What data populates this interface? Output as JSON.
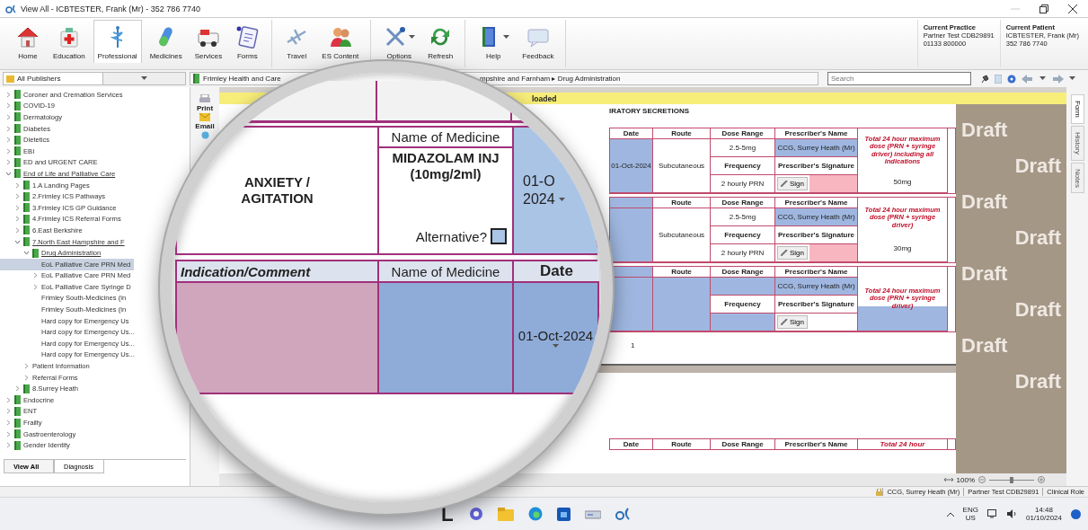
{
  "window": {
    "title": "View All  -  ICBTESTER, Frank (Mr)  -  352 786 7740"
  },
  "ribbon": {
    "groups": [
      [
        {
          "label": "Home",
          "selected": false,
          "has_menu": false
        },
        {
          "label": "Education",
          "selected": false,
          "has_menu": false
        },
        {
          "label": "Professional",
          "selected": true,
          "has_menu": false
        },
        {
          "label": "Medicines",
          "selected": false,
          "has_menu": false
        },
        {
          "label": "Services",
          "selected": false,
          "has_menu": false
        },
        {
          "label": "Forms",
          "selected": false,
          "has_menu": false
        }
      ],
      [
        {
          "label": "Travel",
          "selected": false,
          "has_menu": false
        },
        {
          "label": "ES Content",
          "selected": false,
          "has_menu": false
        }
      ],
      [
        {
          "label": "Options",
          "selected": false,
          "has_menu": true
        },
        {
          "label": "Refresh",
          "selected": false,
          "has_menu": false
        }
      ],
      [
        {
          "label": "Help",
          "selected": false,
          "has_menu": true
        },
        {
          "label": "Feedback",
          "selected": false,
          "has_menu": false
        }
      ]
    ]
  },
  "current_practice": {
    "heading": "Current Practice",
    "lines": [
      "Partner Test CDB29891",
      "01133 800000"
    ]
  },
  "current_patient": {
    "heading": "Current Patient",
    "lines": [
      "ICBTESTER, Frank (Mr)",
      "352 786 7740"
    ]
  },
  "navigation": {
    "publisher": "All Publishers",
    "breadcrumb_start": "Frimley Health and Care",
    "breadcrumb_end": "mpshire and Farnham ▸ Drug Administration",
    "search_placeholder": "Search"
  },
  "sidebar": {
    "tree": [
      {
        "label": "Coroner and Cremation Services",
        "expanded": false,
        "selected": false
      },
      {
        "label": "COVID-19",
        "expanded": false,
        "selected": false
      },
      {
        "label": "Dermatology",
        "expanded": false,
        "selected": false
      },
      {
        "label": "Diabetes",
        "expanded": false,
        "selected": false
      },
      {
        "label": "Dietetics",
        "expanded": false,
        "selected": false
      },
      {
        "label": "EBI",
        "expanded": false,
        "selected": false
      },
      {
        "label": "ED and URGENT CARE",
        "expanded": false,
        "selected": false
      },
      {
        "label": "End of Life and Palliative Care",
        "expanded": true,
        "selected": false,
        "children": [
          {
            "label": "1.A Landing Pages",
            "expanded": false,
            "selected": false
          },
          {
            "label": "2.Frimley ICS Pathways",
            "expanded": false,
            "selected": false
          },
          {
            "label": "3.Frimley ICS GP Guidance",
            "expanded": false,
            "selected": false
          },
          {
            "label": "4.Frimley ICS Referral Forms",
            "expanded": false,
            "selected": false
          },
          {
            "label": "6.East Berkshire",
            "expanded": false,
            "selected": false
          },
          {
            "label": "7.North East Hampshire and F",
            "expanded": true,
            "selected": false,
            "children": [
              {
                "label": "Drug Administration",
                "expanded": true,
                "selected": false,
                "children": [
                  {
                    "label": "EoL Palliative Care PRN Med",
                    "selected": true
                  },
                  {
                    "label": "EoL Palliative Care PRN Med",
                    "expanded": false,
                    "selected": false
                  },
                  {
                    "label": "EoL Palliative Care Syringe D",
                    "expanded": false,
                    "selected": false
                  },
                  {
                    "label": "Frimley South-Medicines (in",
                    "selected": false
                  },
                  {
                    "label": "Frimley South-Medicines (in",
                    "selected": false
                  },
                  {
                    "label": "Hard copy for Emergency Us",
                    "selected": false
                  },
                  {
                    "label": "Hard copy for Emergency Us...",
                    "selected": false
                  },
                  {
                    "label": "Hard copy for Emergency Us...",
                    "selected": false
                  },
                  {
                    "label": "Hard copy for Emergency Us...",
                    "selected": false
                  }
                ]
              },
              {
                "label": "Patient Information",
                "expanded": false,
                "selected": false
              },
              {
                "label": "Referral Forms",
                "expanded": false,
                "selected": false
              }
            ]
          },
          {
            "label": "8.Surrey Heath",
            "expanded": false,
            "selected": false
          }
        ]
      },
      {
        "label": "Endocrine",
        "expanded": false,
        "selected": false
      },
      {
        "label": "ENT",
        "expanded": false,
        "selected": false
      },
      {
        "label": "Frailty",
        "expanded": false,
        "selected": false
      },
      {
        "label": "Gastroenterology",
        "expanded": false,
        "selected": false
      },
      {
        "label": "Gender Identity",
        "expanded": false,
        "selected": false
      }
    ],
    "tabs": [
      {
        "label": "View All",
        "selected": true
      },
      {
        "label": "Diagnosis",
        "selected": false
      }
    ]
  },
  "document": {
    "tools": [
      "Print",
      "Email"
    ],
    "notice": "loaded",
    "section_title": "IRATORY SECRETIONS",
    "prescriptions": [
      {
        "kind": "completed",
        "headers": [
          "Date",
          "Route",
          "Dose Range",
          "Prescriber's Name"
        ],
        "date": "01-Oct-2024",
        "route": "Subcutaneous",
        "dose_range": "2.5-5mg",
        "prescriber": "CCG, Surrey Heath (Mr)",
        "frequency_label": "Frequency",
        "signature_label": "Prescriber's Signature",
        "frequency": "2 hourly PRN",
        "sign_button": "Sign",
        "total_label": "Total 24 hour maximum dose (PRN + syringe driver) including all indications",
        "total": "50mg"
      },
      {
        "kind": "completed",
        "headers": [
          "Route",
          "Dose Range",
          "Prescriber's Name"
        ],
        "route": "Subcutaneous",
        "dose_range": "2.5-5mg",
        "prescriber": "CCG, Surrey Heath (Mr)",
        "frequency_label": "Frequency",
        "signature_label": "Prescriber's Signature",
        "frequency": "2 hourly PRN",
        "sign_button": "Sign",
        "total_label": "Total 24 hour maximum dose (PRN + syringe driver)",
        "total": "30mg"
      },
      {
        "kind": "new",
        "headers": [
          "Route",
          "Dose Range",
          "Prescriber's Name"
        ],
        "prescriber": "CCG, Surrey Heath (Mr)",
        "frequency_label": "Frequency",
        "signature_label": "Prescriber's Signature",
        "sign_button": "Sign",
        "total_label": "Total 24 hour maximum dose (PRN + syringe driver)"
      }
    ],
    "page_number": "1",
    "next_page_headers": [
      "Date",
      "Route",
      "Dose Range",
      "Prescriber's Name",
      "Total 24 hour"
    ],
    "draft_marks": [
      "Draft",
      "Draft",
      "Draft",
      "Draft",
      "Draft",
      "Draft",
      "Draft",
      "Draft"
    ],
    "zoom": {
      "value": "100%",
      "level": 0.5
    }
  },
  "side_tabs": [
    {
      "label": "Form",
      "selected": true
    },
    {
      "label": "History",
      "selected": false
    },
    {
      "label": "Notes",
      "selected": false
    }
  ],
  "magnifier": {
    "indication": "ANXIETY / AGITATION",
    "medicine_header": "Name of Medicine",
    "medicine": "MIDAZOLAM INJ (10mg/2ml)",
    "alternative_label": "Alternative?",
    "alternative_checked": false,
    "date_lines": [
      "01-O",
      "2024"
    ],
    "headers": [
      "Indication/Comment",
      "Name of Medicine",
      "Date"
    ],
    "date": "01-Oct-2024"
  },
  "status_bar": [
    "CCG, Surrey Heath (Mr)",
    "Partner Test CDB29891",
    "Clinical Role"
  ],
  "taskbar": {
    "language": "ENG",
    "region": "US",
    "time": "14:48",
    "date": "01/10/2024"
  }
}
